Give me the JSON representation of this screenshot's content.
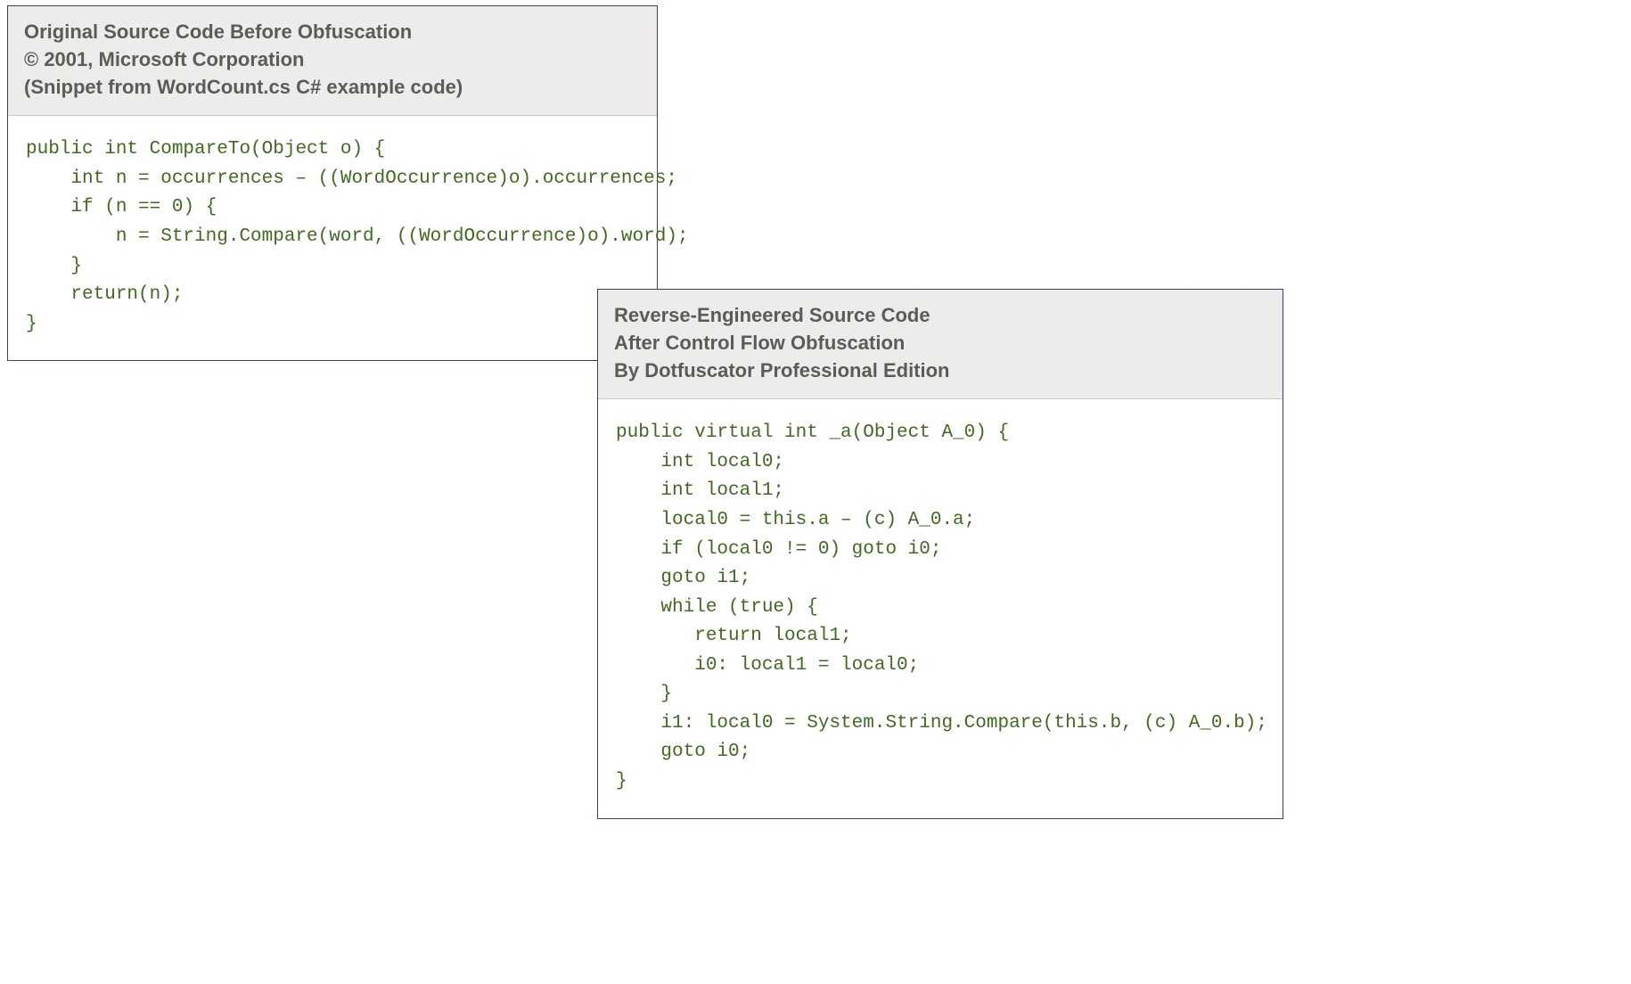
{
  "panel1": {
    "header": {
      "line1": "Original Source Code Before Obfuscation",
      "line2": "© 2001, Microsoft Corporation",
      "line3": "(Snippet from WordCount.cs C# example code)"
    },
    "code": "public int CompareTo(Object o) {\n    int n = occurrences – ((WordOccurrence)o).occurrences;\n    if (n == 0) {\n        n = String.Compare(word, ((WordOccurrence)o).word);\n    }\n    return(n);\n}"
  },
  "panel2": {
    "header": {
      "line1": "Reverse-Engineered Source Code",
      "line2": "After Control Flow Obfuscation",
      "line3": "By Dotfuscator Professional Edition"
    },
    "code": "public virtual int _a(Object A_0) {\n    int local0;\n    int local1;\n    local0 = this.a – (c) A_0.a;\n    if (local0 != 0) goto i0;\n    goto i1;\n    while (true) {\n       return local1;\n       i0: local1 = local0;\n    }\n    i1: local0 = System.String.Compare(this.b, (c) A_0.b);\n    goto i0;\n}"
  }
}
